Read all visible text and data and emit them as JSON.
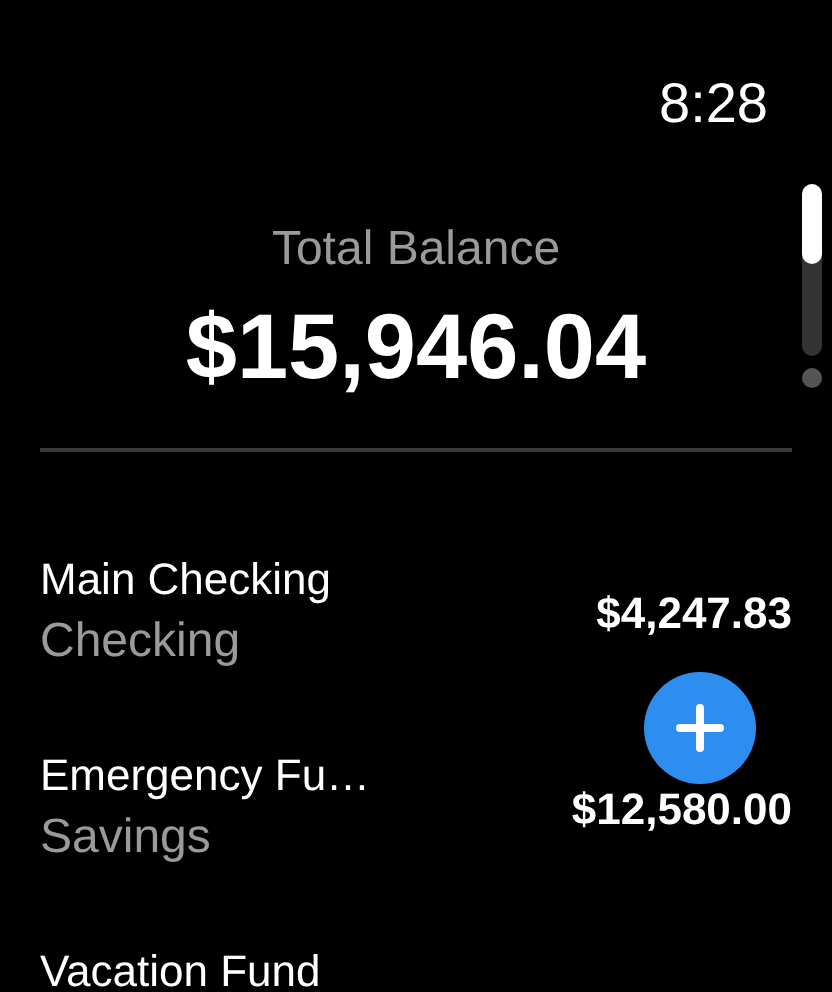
{
  "status_bar": {
    "time": "8:28"
  },
  "summary": {
    "label": "Total Balance",
    "amount": "$15,946.04"
  },
  "accounts": [
    {
      "name": "Main Checking",
      "type": "Checking",
      "balance": "$4,247.83"
    },
    {
      "name": "Emergency Fu…",
      "type": "Savings",
      "balance": "$12,580.00"
    },
    {
      "name": "Vacation Fund"
    }
  ]
}
